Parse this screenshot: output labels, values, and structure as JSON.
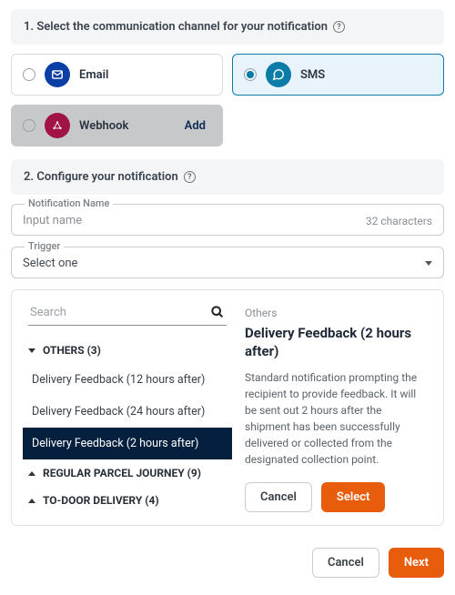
{
  "step1": {
    "title": "1. Select the communication channel for your notification"
  },
  "channels": {
    "email": {
      "label": "Email"
    },
    "sms": {
      "label": "SMS"
    },
    "webhook": {
      "label": "Webhook",
      "add": "Add"
    }
  },
  "step2": {
    "title": "2. Configure your notification"
  },
  "nameField": {
    "legend": "Notification Name",
    "placeholder": "Input name",
    "charCount": "32 characters"
  },
  "triggerField": {
    "legend": "Trigger",
    "value": "Select one"
  },
  "dropdown": {
    "searchPlaceholder": "Search",
    "groups": [
      {
        "label": "OTHERS (3)",
        "expanded": true
      },
      {
        "label": "REGULAR PARCEL JOURNEY (9)",
        "expanded": false
      },
      {
        "label": "TO-DOOR DELIVERY (4)",
        "expanded": false
      }
    ],
    "othersOptions": [
      "Delivery Feedback (12 hours after)",
      "Delivery Feedback (24 hours after)",
      "Delivery Feedback (2 hours after)"
    ]
  },
  "detail": {
    "category": "Others",
    "title": "Delivery Feedback (2 hours after)",
    "description": "Standard notification prompting the recipient to provide feedback. It will be sent out 2 hours after the shipment has been successfully delivered or collected from the designated collection point.",
    "cancel": "Cancel",
    "select": "Select"
  },
  "footer": {
    "cancel": "Cancel",
    "next": "Next"
  },
  "colors": {
    "emailIcon": "#0b3fa5",
    "smsIcon": "#0b7ca8",
    "webhookIcon": "#a11344",
    "accent": "#e85d0c",
    "activeRow": "#05203f"
  }
}
